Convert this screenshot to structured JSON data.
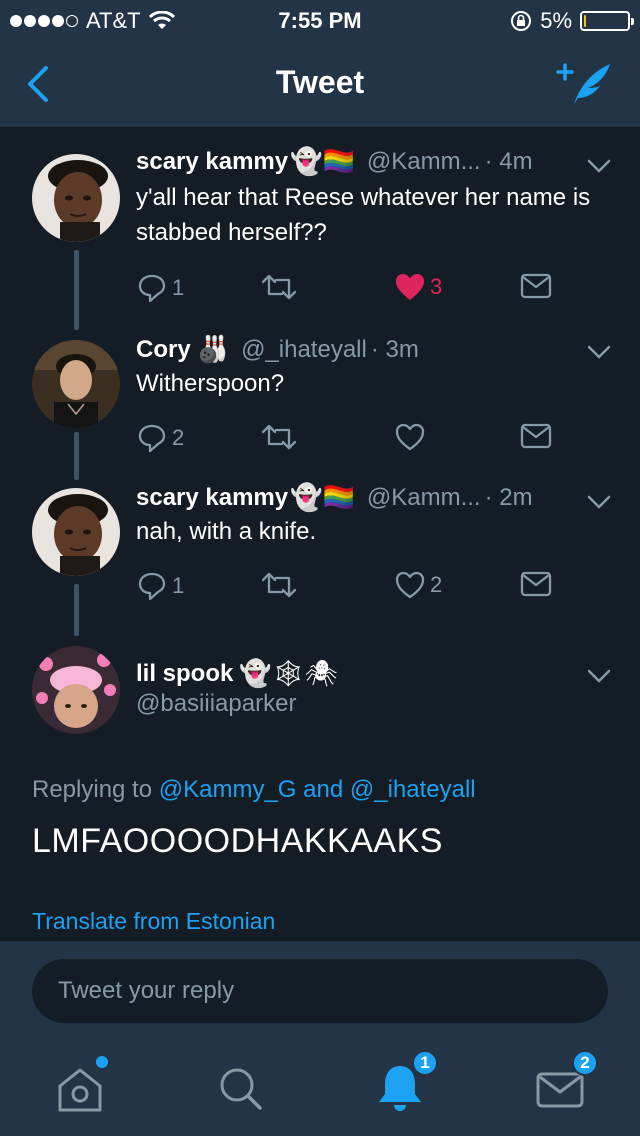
{
  "status_bar": {
    "carrier": "AT&T",
    "time": "7:55 PM",
    "battery_text": "5%",
    "battery_level": 0.05
  },
  "nav": {
    "title": "Tweet",
    "back_icon": "chevron-left-icon",
    "compose_icon": "compose-tweet-icon"
  },
  "tweets": [
    {
      "name": "scary kammy",
      "emojis": "👻🏳️‍🌈",
      "handle": "@Kamm...",
      "time": "· 4m",
      "text": "y'all hear that Reese whatever her name is stabbed herself??",
      "replies": "1",
      "retweets": "",
      "likes": "3",
      "liked": true
    },
    {
      "name": "Cory",
      "emojis": "🎳",
      "handle": "@_ihateyall",
      "time": "· 3m",
      "text": "Witherspoon?",
      "replies": "2",
      "retweets": "",
      "likes": "",
      "liked": false
    },
    {
      "name": "scary kammy",
      "emojis": "👻🏳️‍🌈",
      "handle": "@Kamm...",
      "time": "· 2m",
      "text": "nah, with a knife.",
      "replies": "1",
      "retweets": "",
      "likes": "2",
      "liked": false
    }
  ],
  "main_tweet": {
    "name": "lil spook",
    "emojis": "👻🕸🕷",
    "handle": "@basiiiaparker",
    "replying_prefix": "Replying to",
    "mention_1": "@Kammy_G",
    "and_word": "and",
    "mention_2": "@_ihateyall",
    "text": "LMFAOOOODHAKKAAKS",
    "translate": "Translate from Estonian"
  },
  "reply_bar": {
    "placeholder": "Tweet your reply"
  },
  "tabs": [
    {
      "icon": "home-icon",
      "badge": ""
    },
    {
      "icon": "search-icon",
      "badge": ""
    },
    {
      "icon": "notifications-icon",
      "badge": "1"
    },
    {
      "icon": "messages-icon",
      "badge": "2"
    }
  ],
  "colors": {
    "background": "#141d26",
    "bar": "#243447",
    "accent": "#1da1f2",
    "muted": "#8899a6",
    "like": "#e0245e"
  }
}
